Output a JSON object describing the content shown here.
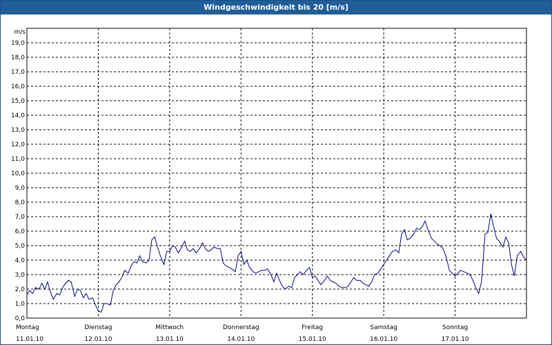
{
  "window": {
    "title": "Windgeschwindigkeit bis 20 [m/s]"
  },
  "chart_data": {
    "type": "line",
    "title": "Windgeschwindigkeit bis 20 [m/s]",
    "ylabel": "m/s",
    "xlabel": "",
    "ylim": [
      0,
      20
    ],
    "xlim": [
      0,
      7
    ],
    "grid": true,
    "y_ticks": [
      "0,0",
      "1,0",
      "2,0",
      "3,0",
      "4,0",
      "5,0",
      "6,0",
      "7,0",
      "8,0",
      "9,0",
      "10,0",
      "11,0",
      "12,0",
      "13,0",
      "14,0",
      "15,0",
      "16,0",
      "17,0",
      "18,0",
      "19,0"
    ],
    "x_ticks": [
      {
        "day": "Montag",
        "date": "11.01.10"
      },
      {
        "day": "Dienstag",
        "date": "12.01.10"
      },
      {
        "day": "Mittwoch",
        "date": "13.01.10"
      },
      {
        "day": "Donnerstag",
        "date": "14.01.10"
      },
      {
        "day": "Freitag",
        "date": "15.01.10"
      },
      {
        "day": "Samstag",
        "date": "16.01.10"
      },
      {
        "day": "Sonntag",
        "date": "17.01.10"
      }
    ],
    "series": [
      {
        "color": "#00007f",
        "x": [
          0,
          0.04,
          0.08,
          0.12,
          0.17,
          0.21,
          0.25,
          0.29,
          0.33,
          0.37,
          0.42,
          0.46,
          0.5,
          0.54,
          0.58,
          0.62,
          0.67,
          0.71,
          0.75,
          0.79,
          0.83,
          0.87,
          0.92,
          0.96,
          1.0,
          1.04,
          1.08,
          1.12,
          1.17,
          1.21,
          1.25,
          1.29,
          1.33,
          1.37,
          1.42,
          1.46,
          1.5,
          1.54,
          1.58,
          1.62,
          1.67,
          1.71,
          1.75,
          1.79,
          1.83,
          1.87,
          1.92,
          1.96,
          2.0,
          2.04,
          2.08,
          2.12,
          2.17,
          2.21,
          2.25,
          2.29,
          2.33,
          2.37,
          2.42,
          2.46,
          2.5,
          2.54,
          2.58,
          2.62,
          2.67,
          2.71,
          2.75,
          2.79,
          2.83,
          2.87,
          2.92,
          2.96,
          3.0,
          3.04,
          3.08,
          3.12,
          3.17,
          3.21,
          3.25,
          3.29,
          3.33,
          3.37,
          3.42,
          3.46,
          3.5,
          3.54,
          3.58,
          3.62,
          3.67,
          3.71,
          3.75,
          3.79,
          3.83,
          3.87,
          3.92,
          3.96,
          4.0,
          4.04,
          4.08,
          4.12,
          4.17,
          4.21,
          4.25,
          4.29,
          4.33,
          4.37,
          4.42,
          4.46,
          4.5,
          4.54,
          4.58,
          4.62,
          4.67,
          4.71,
          4.75,
          4.79,
          4.83,
          4.87,
          4.92,
          4.96,
          5.0,
          5.04,
          5.08,
          5.12,
          5.17,
          5.21,
          5.25,
          5.29,
          5.33,
          5.37,
          5.42,
          5.46,
          5.5,
          5.54,
          5.58,
          5.62,
          5.67,
          5.71,
          5.75,
          5.79,
          5.83,
          5.87,
          5.92,
          5.96,
          6.0,
          6.04,
          6.08,
          6.12,
          6.17,
          6.21,
          6.25,
          6.29,
          6.33,
          6.37,
          6.42,
          6.46,
          6.5,
          6.54,
          6.58,
          6.62,
          6.67,
          6.71,
          6.75,
          6.79,
          6.83,
          6.87,
          6.92,
          6.96,
          7.0
        ],
        "y": [
          1.6,
          1.9,
          1.7,
          2.1,
          2.0,
          2.4,
          2.0,
          2.5,
          1.8,
          1.3,
          1.7,
          1.6,
          2.1,
          2.4,
          2.6,
          2.5,
          1.5,
          2.0,
          1.9,
          1.4,
          1.7,
          1.3,
          1.4,
          0.9,
          0.5,
          0.4,
          1.0,
          1.0,
          0.9,
          1.9,
          2.3,
          2.5,
          2.8,
          3.3,
          3.1,
          3.6,
          3.9,
          3.8,
          4.3,
          3.9,
          3.8,
          4.0,
          5.4,
          5.6,
          4.9,
          4.3,
          3.7,
          4.6,
          4.6,
          5.0,
          4.9,
          4.5,
          4.9,
          5.3,
          4.7,
          4.6,
          4.8,
          4.5,
          4.8,
          5.2,
          4.8,
          4.6,
          4.7,
          4.9,
          4.8,
          4.8,
          3.8,
          3.6,
          3.5,
          3.4,
          3.2,
          4.3,
          4.6,
          3.7,
          4.0,
          3.5,
          3.2,
          3.1,
          3.2,
          3.3,
          3.3,
          3.4,
          3.0,
          2.5,
          3.1,
          2.6,
          2.2,
          2.0,
          2.2,
          2.1,
          2.8,
          3.0,
          3.2,
          3.0,
          3.3,
          3.5,
          2.8,
          2.9,
          2.6,
          2.3,
          2.6,
          2.9,
          2.6,
          2.5,
          2.4,
          2.2,
          2.1,
          2.1,
          2.2,
          2.5,
          2.8,
          2.6,
          2.6,
          2.4,
          2.3,
          2.2,
          2.5,
          3.0,
          3.1,
          3.4,
          3.7,
          4.0,
          4.3,
          4.6,
          4.7,
          4.5,
          5.8,
          6.1,
          5.4,
          5.5,
          5.8,
          6.2,
          6.1,
          6.3,
          6.7,
          6.1,
          5.5,
          5.3,
          5.1,
          5.0,
          4.8,
          4.3,
          3.3,
          3.1,
          2.9,
          3.1,
          3.3,
          3.2,
          3.1,
          3.0,
          2.6,
          2.1,
          1.7,
          2.5,
          5.8,
          5.9,
          7.2,
          6.3,
          5.5,
          5.3,
          4.9,
          5.6,
          5.2,
          3.7,
          2.9,
          4.3,
          4.6,
          4.2,
          4.0
        ]
      }
    ]
  }
}
